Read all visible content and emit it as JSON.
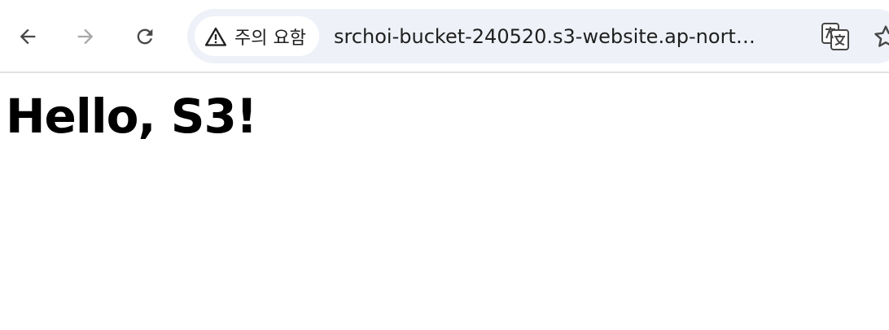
{
  "toolbar": {
    "security_label": "주의 요함",
    "url": "srchoi-bucket-240520.s3-website.ap-nort…"
  },
  "page": {
    "heading": "Hello, S3!"
  },
  "icons": {
    "back": "arrow-left-icon",
    "forward": "arrow-right-icon",
    "reload": "reload-icon",
    "warning": "warning-triangle-icon",
    "translate": "translate-icon",
    "bookmark": "star-icon"
  },
  "colors": {
    "toolbar_bg": "#ffffff",
    "omnibox_bg": "#eef1f8",
    "icon_active": "#474747",
    "icon_disabled": "#a8a8a8",
    "text": "#1f1f1f"
  }
}
